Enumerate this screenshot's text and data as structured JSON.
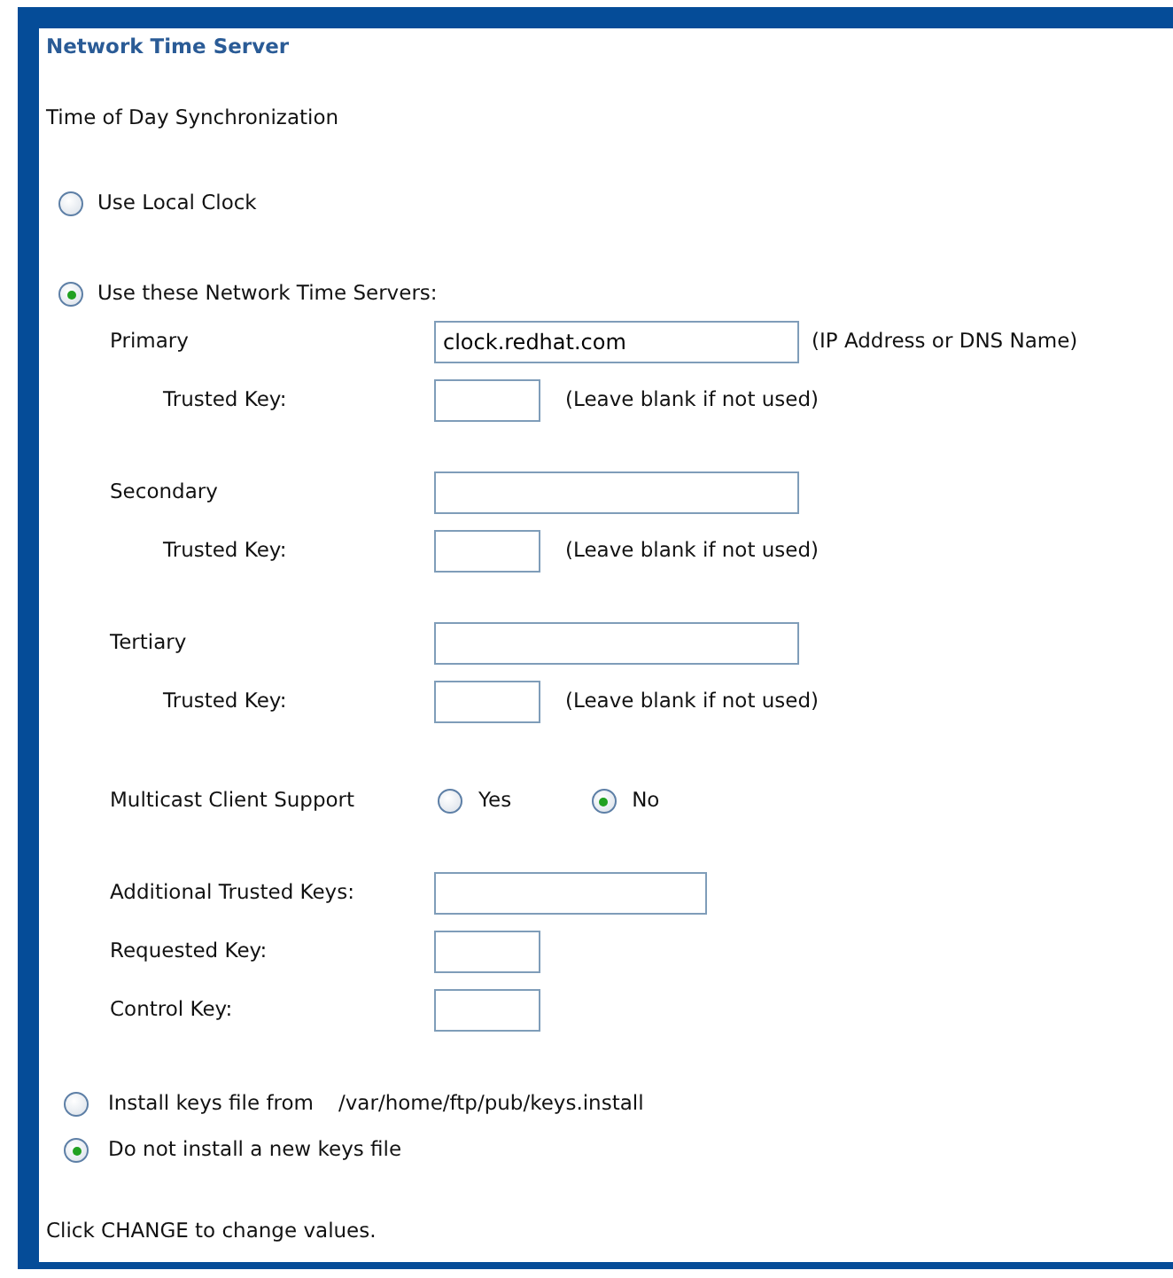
{
  "section_title": "Network Time Server",
  "subtitle": "Time of Day Synchronization",
  "sync_options": [
    {
      "label": "Use Local Clock",
      "selected": false
    },
    {
      "label": "Use these Network Time Servers:",
      "selected": true
    }
  ],
  "servers": [
    {
      "label": "Primary",
      "value": "clock.redhat.com",
      "note": "(IP Address or DNS Name)",
      "trusted_key": {
        "label": "Trusted Key:",
        "note": "(Leave blank if not used)"
      }
    },
    {
      "label": "Secondary",
      "trusted_key": {
        "label": "Trusted Key:",
        "note": "(Leave blank if not used)"
      }
    },
    {
      "label": "Tertiary",
      "trusted_key": {
        "label": "Trusted Key:",
        "note": "(Leave blank if not used)"
      }
    }
  ],
  "multicast": {
    "label": "Multicast Client Support",
    "options": [
      {
        "label": "Yes",
        "selected": false
      },
      {
        "label": "No",
        "selected": true
      }
    ]
  },
  "keys": [
    {
      "label": "Additional Trusted Keys:",
      "kind": "wide"
    },
    {
      "label": "Requested Key:",
      "kind": "short"
    },
    {
      "label": "Control Key:",
      "kind": "short"
    }
  ],
  "keys_file_options": [
    {
      "label": "Install keys file from",
      "path": "/var/home/ftp/pub/keys.install",
      "selected": false
    },
    {
      "label": "Do not install a new keys file",
      "selected": true
    }
  ],
  "footer": "Click CHANGE to change values."
}
